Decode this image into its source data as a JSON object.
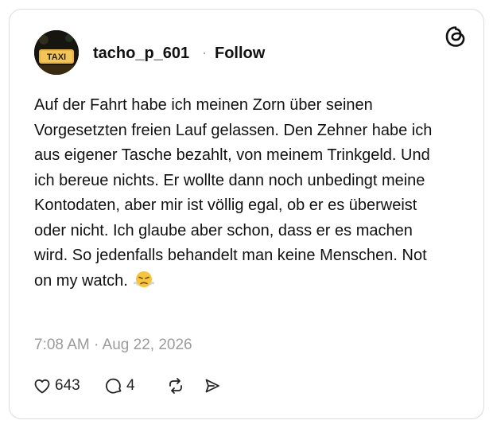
{
  "post": {
    "username": "tacho_p_601",
    "separator": "·",
    "follow_label": "Follow",
    "avatar_sign_text": "TAXI",
    "text": "Auf der Fahrt habe ich meinen Zorn über seinen Vorgesetzten freien Lauf gelassen. Den Zehner habe ich aus eigener Tasche bezahlt, von meinem Trinkgeld. Und ich bereue nichts. Er wollte dann noch unbedingt meine Kontodaten, aber mir ist völlig egal, ob er es überweist oder nicht. Ich glaube aber schon, dass er es machen wird. So jedenfalls behandelt man keine Menschen. Not on my watch.",
    "emoji": "face-with-steam-from-nose",
    "timestamp": "7:08 AM · Aug 22, 2026"
  },
  "actions": {
    "like_count": "643",
    "reply_count": "4",
    "like_icon": "heart-icon",
    "reply_icon": "comment-icon",
    "repost_icon": "repost-icon",
    "share_icon": "send-icon"
  },
  "brand": {
    "logo_icon": "threads-logo-icon"
  },
  "colors": {
    "text": "#111111",
    "muted": "#9b9b9b",
    "border": "#dcdcdc",
    "taxi_sign": "#e8b43a"
  }
}
